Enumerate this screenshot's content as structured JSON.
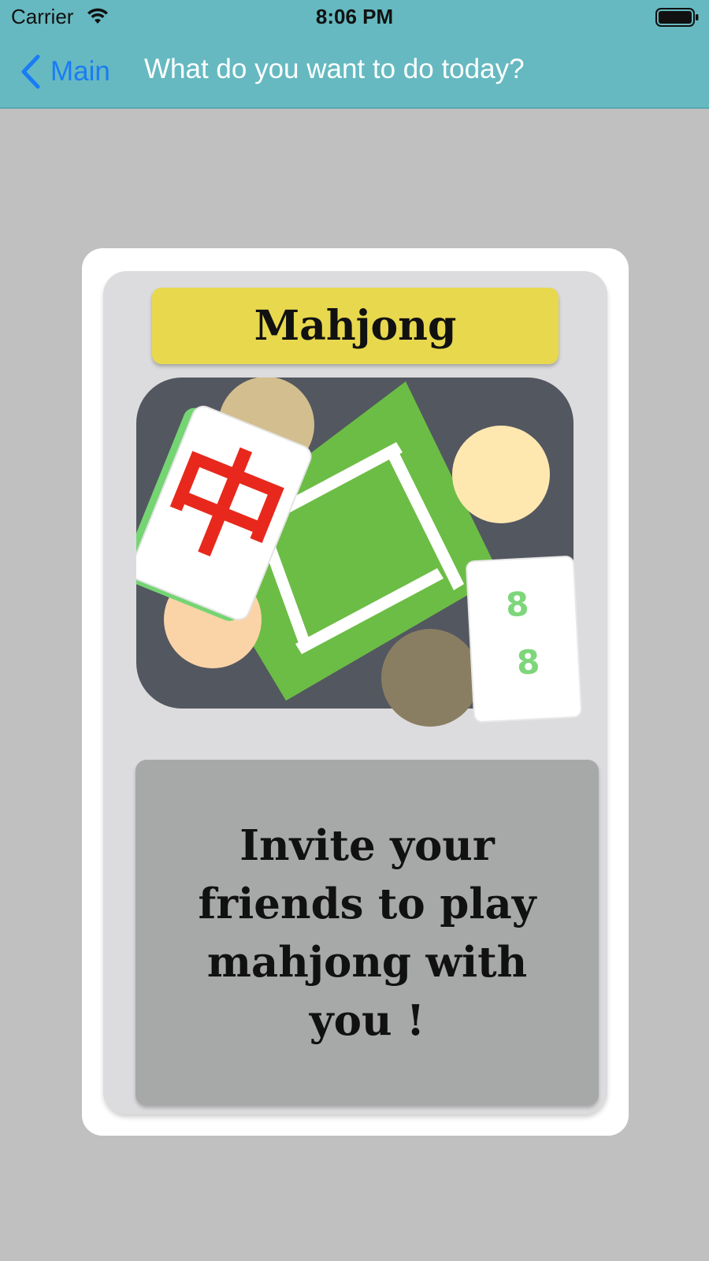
{
  "status_bar": {
    "carrier": "Carrier",
    "time": "8:06 PM",
    "icons": [
      "wifi-icon",
      "battery-icon"
    ]
  },
  "nav": {
    "back_label": "Main",
    "back_icon": "chevron-left-icon",
    "title": "What do you want to do today?"
  },
  "card": {
    "title": "Mahjong",
    "illustration": {
      "tile_red_glyph": "中",
      "tile_green_marks": [
        "8",
        "8"
      ]
    },
    "invite_text": "Invite your friends to play mahjong with you !"
  },
  "colors": {
    "header_bg": "#66b9c0",
    "page_bg": "#c0c0c0",
    "back_link": "#1a7cf5",
    "banner": "#e8d84e",
    "table_felt": "#6cbd45",
    "board": "#535760",
    "invite_panel": "#a7a9a8"
  }
}
